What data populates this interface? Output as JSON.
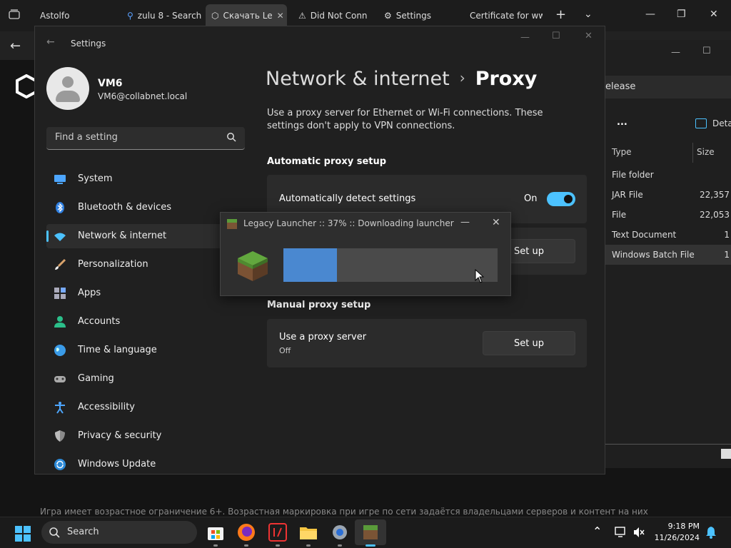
{
  "browser": {
    "tabs": [
      {
        "label": "Astolfo"
      },
      {
        "label": "zulu 8 - Search"
      },
      {
        "label": "Скачать Le"
      },
      {
        "label": "Did Not Conn"
      },
      {
        "label": "Settings"
      },
      {
        "label": "Certificate for ww"
      }
    ]
  },
  "page": {
    "footer_text": "Игра имеет возрастное ограничение 6+. Возрастная маркировка при игре по сети задаётся владельцами серверов и контент на них"
  },
  "explorer": {
    "address": "elease",
    "more": "...",
    "details": "Detai",
    "columns": {
      "type": "Type",
      "size": "Size"
    },
    "rows": [
      {
        "type": "File folder",
        "size": ""
      },
      {
        "type": "JAR File",
        "size": "22,357"
      },
      {
        "type": "File",
        "size": "22,053"
      },
      {
        "type": "Text Document",
        "size": "1"
      },
      {
        "type": "Windows Batch File",
        "size": "1"
      }
    ]
  },
  "settings": {
    "window_title": "Settings",
    "user": {
      "name": "VM6",
      "email": "VM6@collabnet.local"
    },
    "search_placeholder": "Find a setting",
    "nav": [
      {
        "label": "System",
        "icon": "system-icon"
      },
      {
        "label": "Bluetooth & devices",
        "icon": "bluetooth-icon"
      },
      {
        "label": "Network & internet",
        "icon": "network-icon"
      },
      {
        "label": "Personalization",
        "icon": "brush-icon"
      },
      {
        "label": "Apps",
        "icon": "apps-icon"
      },
      {
        "label": "Accounts",
        "icon": "accounts-icon"
      },
      {
        "label": "Time & language",
        "icon": "globe-icon"
      },
      {
        "label": "Gaming",
        "icon": "gamepad-icon"
      },
      {
        "label": "Accessibility",
        "icon": "accessibility-icon"
      },
      {
        "label": "Privacy & security",
        "icon": "shield-icon"
      },
      {
        "label": "Windows Update",
        "icon": "update-icon"
      }
    ],
    "breadcrumb_parent": "Network & internet",
    "breadcrumb_separator": "›",
    "breadcrumb_current": "Proxy",
    "description": "Use a proxy server for Ethernet or Wi-Fi connections. These settings don't apply to VPN connections.",
    "auto_section": "Automatic proxy setup",
    "auto_detect_label": "Automatically detect settings",
    "auto_detect_state": "On",
    "setup_label": "Set up",
    "manual_section": "Manual proxy setup",
    "use_proxy_label": "Use a proxy server",
    "use_proxy_state": "Off"
  },
  "launcher": {
    "title": "Legacy Launcher :: 37% :: Downloading launcher",
    "progress": 0.25
  },
  "taskbar": {
    "search_label": "Search",
    "time": "9:18 PM",
    "date": "11/26/2024"
  },
  "colors": {
    "accent": "#4cc2ff",
    "progress_fill": "#4a88d0"
  }
}
